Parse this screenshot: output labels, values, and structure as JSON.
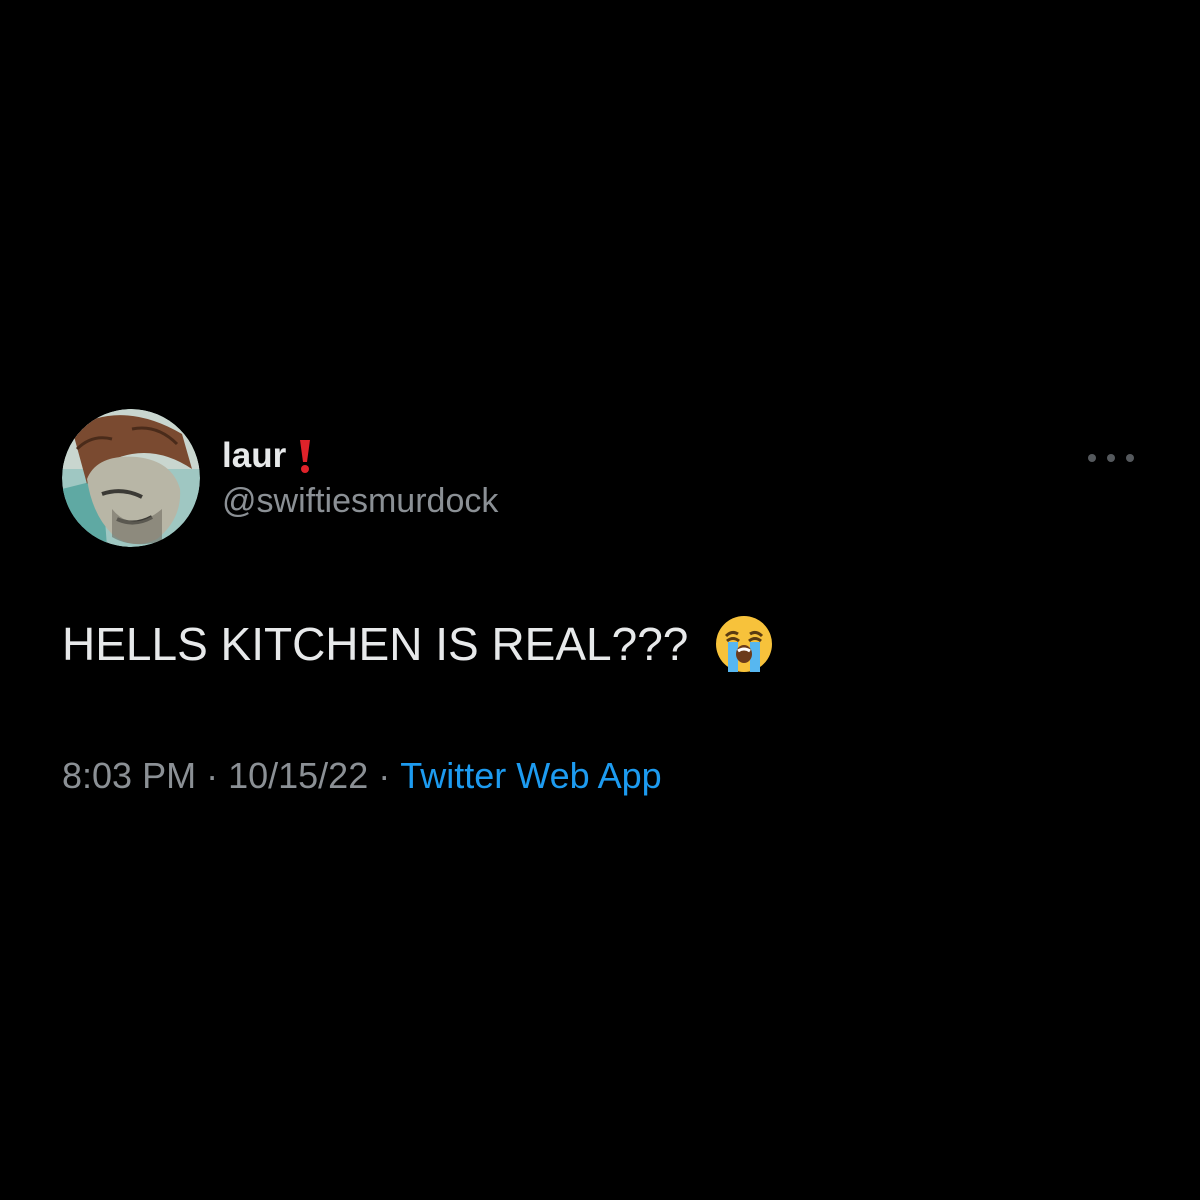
{
  "tweet": {
    "display_name": "laur",
    "name_emoji": "exclamation-mark-icon",
    "handle": "@swiftiesmurdock",
    "text": "HELLS KITCHEN IS REAL???",
    "text_emoji": "loudly-crying-face-icon",
    "time": "8:03 PM",
    "date": "10/15/22",
    "separator": "·",
    "source": "Twitter Web App",
    "more_icon": "more-options-icon"
  },
  "colors": {
    "background": "#000000",
    "primary_text": "#e7e9ea",
    "secondary_text": "#8b9095",
    "link": "#1d9bf0",
    "exclamation": "#e0222a"
  }
}
